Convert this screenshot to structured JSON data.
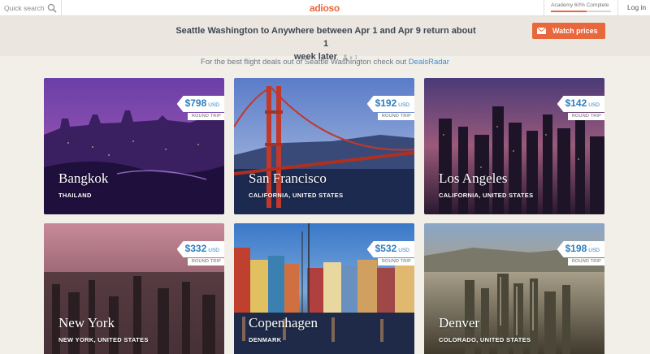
{
  "header": {
    "search_label": "Quick search",
    "logo": "adioso",
    "academy_label": "Academy 60% Complete",
    "academy_progress": 0.6,
    "login_label": "Log in"
  },
  "query": {
    "title_line1": "Seattle Washington to Anywhere between Apr 1 and Apr 9 return about 1",
    "title_line2": "week later",
    "passengers": "x 1",
    "watch_label": "Watch prices"
  },
  "tip": {
    "text": "For the best flight deals out of Seattle Washington check out",
    "link": "DealsRadar"
  },
  "colors": {
    "accent": "#e8673c",
    "price": "#2f7fbf",
    "link": "#3d8ccc"
  },
  "deals": [
    {
      "city": "Bangkok",
      "country": "THAILAND",
      "price": "$798",
      "currency": "USD",
      "trip": "ROUND TRIP"
    },
    {
      "city": "San Francisco",
      "country": "CALIFORNIA, UNITED STATES",
      "price": "$192",
      "currency": "USD",
      "trip": "ROUND TRIP"
    },
    {
      "city": "Los Angeles",
      "country": "CALIFORNIA, UNITED STATES",
      "price": "$142",
      "currency": "USD",
      "trip": "ROUND TRIP"
    },
    {
      "city": "New York",
      "country": "NEW YORK, UNITED STATES",
      "price": "$332",
      "currency": "USD",
      "trip": "ROUND TRIP"
    },
    {
      "city": "Copenhagen",
      "country": "DENMARK",
      "price": "$532",
      "currency": "USD",
      "trip": "ROUND TRIP"
    },
    {
      "city": "Denver",
      "country": "COLORADO, UNITED STATES",
      "price": "$198",
      "currency": "USD",
      "trip": "ROUND TRIP"
    }
  ]
}
